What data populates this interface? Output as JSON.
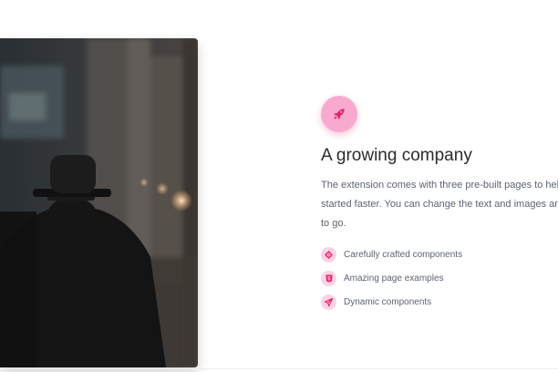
{
  "feature": {
    "icon": "rocket-icon",
    "title": "A growing company",
    "description": "The extension comes with three pre-built pages to help you get started faster. You can change the text and images and you're good to go."
  },
  "list": [
    {
      "icon": "settings-icon",
      "label": "Carefully crafted components"
    },
    {
      "icon": "html5-icon",
      "label": "Amazing page examples"
    },
    {
      "icon": "paper-plane-icon",
      "label": "Dynamic components"
    }
  ],
  "colors": {
    "accent": "#e91e63",
    "icon_bg": "#f7a9cf",
    "badge_bg": "#fbd3e6",
    "text": "#5d6470",
    "heading": "#2b2b2b"
  }
}
